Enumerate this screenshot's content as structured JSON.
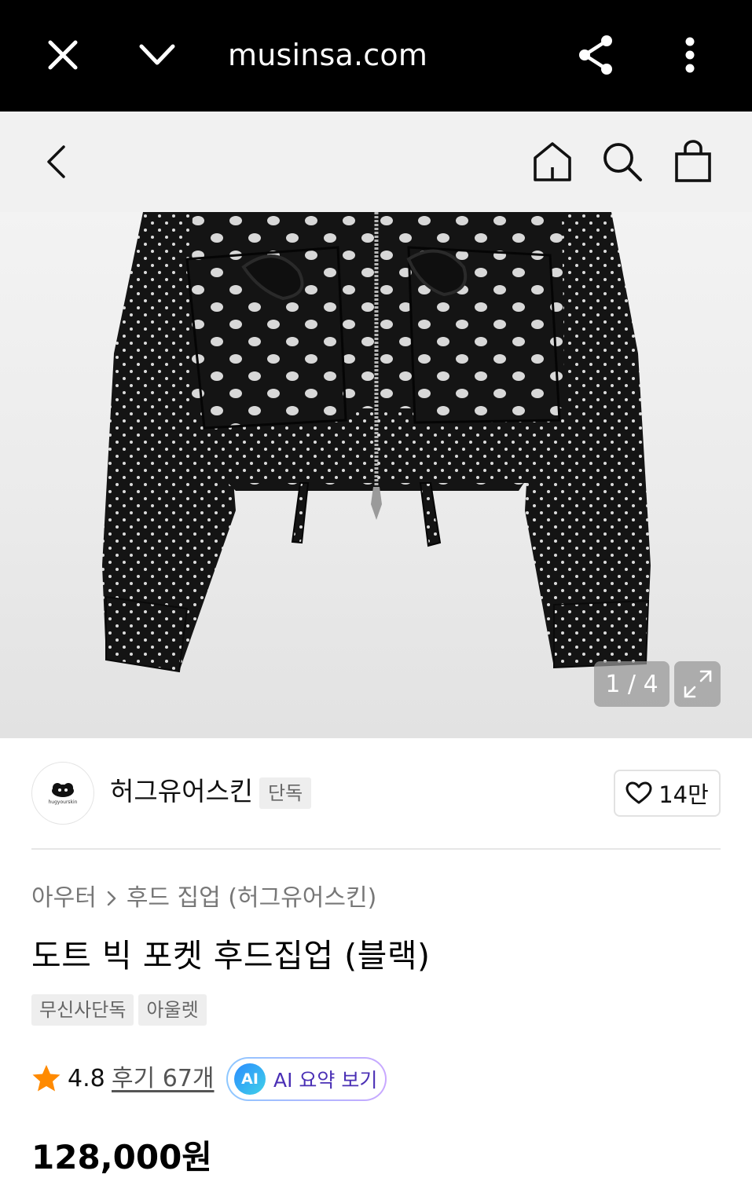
{
  "browser": {
    "url": "musinsa.com",
    "icons": [
      "close-icon",
      "chevron-down-icon",
      "share-icon",
      "more-vertical-icon"
    ]
  },
  "header": {
    "icons": [
      "back-arrow-icon",
      "home-icon",
      "search-icon",
      "shopping-bag-icon"
    ]
  },
  "gallery": {
    "counter": "1 / 4",
    "current_image": 1,
    "total_images": 4
  },
  "brand": {
    "name": "허그유어스킨",
    "logo_text": "hugyourskin",
    "exclusive_tag": "단독",
    "like_count": "14만"
  },
  "breadcrumb": {
    "category": "아우터",
    "subcategory": "후드 집업 (허그유어스킨)"
  },
  "product": {
    "title": "도트 빅 포켓 후드집업 (블랙)",
    "tags": [
      "무신사단독",
      "아울렛"
    ],
    "rating": "4.8",
    "reviews": "후기 67개",
    "ai_badge": "AI",
    "ai_summary_label": "AI 요약 보기",
    "price": "128,000원"
  },
  "colors": {
    "browser_bar": "#000000",
    "header_bg": "#f1f1f1",
    "star": "#ff8a00",
    "ai_text": "#4a2fb5"
  }
}
